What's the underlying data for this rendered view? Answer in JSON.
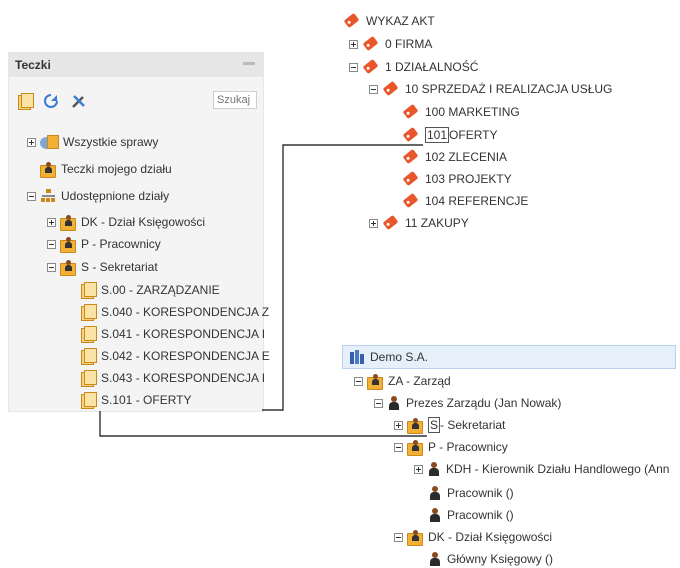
{
  "left_panel": {
    "title": "Teczki",
    "search_placeholder": "Szukaj",
    "tree": [
      {
        "label": "Wszystkie sprawy",
        "expander": "plus"
      },
      {
        "label": "Teczki mojego działu"
      },
      {
        "label": "Udostępnione działy",
        "expander": "minus"
      },
      {
        "label": "DK - Dział Księgowości",
        "expander": "plus"
      },
      {
        "label": "P - Pracownicy",
        "expander": "minus"
      },
      {
        "label": "S - Sekretariat",
        "expander": "minus"
      },
      {
        "label": "S.00 - ZARZĄDZANIE"
      },
      {
        "label": "S.040 - KORESPONDENCJA Z"
      },
      {
        "label": "S.041 - KORESPONDENCJA I"
      },
      {
        "label": "S.042 - KORESPONDENCJA E"
      },
      {
        "label": "S.043 - KORESPONDENCJA I"
      },
      {
        "label": "S.101 - OFERTY"
      }
    ]
  },
  "catalog_tree": {
    "root": "WYKAZ AKT",
    "items": [
      {
        "label": "0 FIRMA",
        "expander": "plus"
      },
      {
        "label": "1 DZIAŁALNOŚĆ",
        "expander": "minus"
      },
      {
        "label": "10 SPRZEDAŻ I REALIZACJA USŁUG",
        "expander": "minus"
      },
      {
        "label": "100 MARKETING"
      },
      {
        "code": "101",
        "rest": " OFERTY"
      },
      {
        "label": "102 ZLECENIA"
      },
      {
        "label": "103 PROJEKTY"
      },
      {
        "label": "104 REFERENCJE"
      },
      {
        "label": "11 ZAKUPY",
        "expander": "plus"
      }
    ]
  },
  "org_tree": {
    "company": "Demo S.A.",
    "items": [
      {
        "label": "ZA - Zarząd",
        "expander": "minus"
      },
      {
        "label": "Prezes Zarządu (Jan Nowak)",
        "expander": "minus"
      },
      {
        "code": "S",
        "rest": " - Sekretariat",
        "expander": "plus"
      },
      {
        "label": "P - Pracownicy",
        "expander": "minus"
      },
      {
        "label": "KDH - Kierownik Działu Handlowego (Ann",
        "expander": "plus"
      },
      {
        "label": "Pracownik ()"
      },
      {
        "label": "Pracownik ()"
      },
      {
        "label": "DK - Dział Księgowości",
        "expander": "minus"
      },
      {
        "label": "Główny Księgowy ()"
      }
    ]
  },
  "colors": {
    "tag": "#e8562a",
    "folder": "#f2b134",
    "company_bar": "#e6f0fb",
    "panel_bg": "#f4f4f4"
  }
}
